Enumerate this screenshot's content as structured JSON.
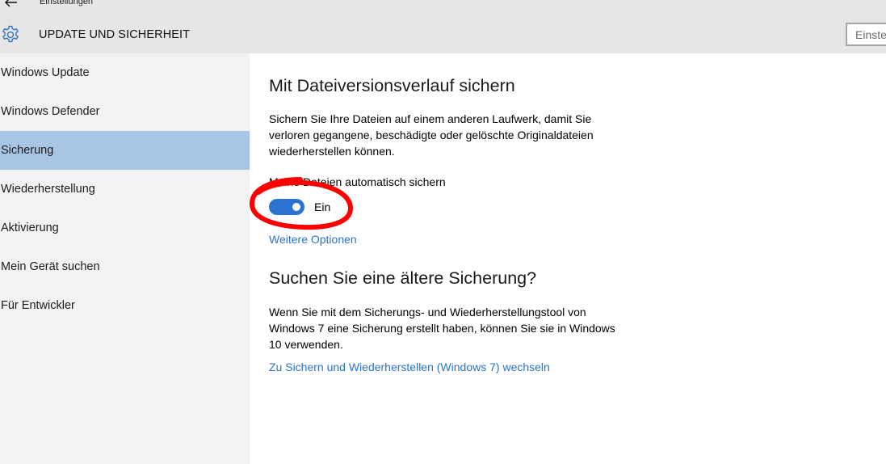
{
  "window": {
    "app_title": "Einstellungen",
    "page_title": "UPDATE UND SICHERHEIT",
    "search_placeholder": "Einste"
  },
  "sidebar": {
    "items": [
      {
        "label": "Windows Update",
        "active": false
      },
      {
        "label": "Windows Defender",
        "active": false
      },
      {
        "label": "Sicherung",
        "active": true
      },
      {
        "label": "Wiederherstellung",
        "active": false
      },
      {
        "label": "Aktivierung",
        "active": false
      },
      {
        "label": "Mein Gerät suchen",
        "active": false
      },
      {
        "label": "Für Entwickler",
        "active": false
      }
    ]
  },
  "main": {
    "backup_heading": "Mit Dateiversionsverlauf sichern",
    "backup_description": "Sichern Sie Ihre Dateien auf einem anderen Laufwerk, damit Sie verloren gegangene, beschädigte oder gelöschte Originaldateien wiederherstellen können.",
    "auto_backup_label": "Meine Dateien automatisch sichern",
    "auto_backup_state": "Ein",
    "auto_backup_on": true,
    "more_options_link": "Weitere Optionen",
    "older_heading": "Suchen Sie eine ältere Sicherung?",
    "older_description": "Wenn Sie mit dem Sicherungs- und Wiederherstellungstool von Windows 7 eine Sicherung erstellt haben, können Sie sie in Windows 10 verwenden.",
    "win7_link": "Zu Sichern und Wiederherstellen (Windows 7) wechseln"
  },
  "colors": {
    "accent": "#2b73d0",
    "link": "#2a74c9",
    "selected_nav": "#a8c5e4",
    "annotation": "#ff0000"
  }
}
